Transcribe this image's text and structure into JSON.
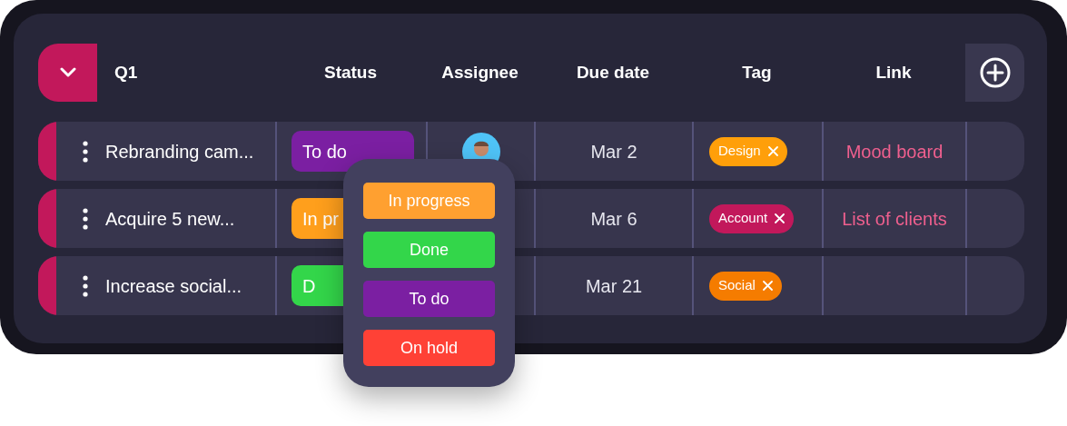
{
  "group": {
    "title": "Q1",
    "expanded": true
  },
  "columns": [
    "Status",
    "Assignee",
    "Due date",
    "Tag",
    "Link"
  ],
  "rows": [
    {
      "name": "Rebranding cam...",
      "status": {
        "label": "To do",
        "color": "#7b1fa2"
      },
      "avatar": true,
      "due": "Mar 2",
      "tag": {
        "label": "Design",
        "color": "#ff9f0a"
      },
      "link": "Mood board"
    },
    {
      "name": "Acquire 5 new...",
      "status": {
        "label": "In pr",
        "color": "#ff9f1c"
      },
      "due": "Mar 6",
      "tag": {
        "label": "Account",
        "color": "#c2185b"
      },
      "link": "List of clients"
    },
    {
      "name": "Increase social...",
      "status": {
        "label": "D",
        "color": "#33d64a"
      },
      "due": "Mar 21",
      "tag": {
        "label": "Social",
        "color": "#f57c00"
      }
    }
  ],
  "status_menu": {
    "options": [
      {
        "label": "In progress",
        "color": "#ffa030"
      },
      {
        "label": "Done",
        "color": "#33d64a"
      },
      {
        "label": "To do",
        "color": "#7b1fa2"
      },
      {
        "label": "On hold",
        "color": "#ff4136"
      }
    ]
  }
}
